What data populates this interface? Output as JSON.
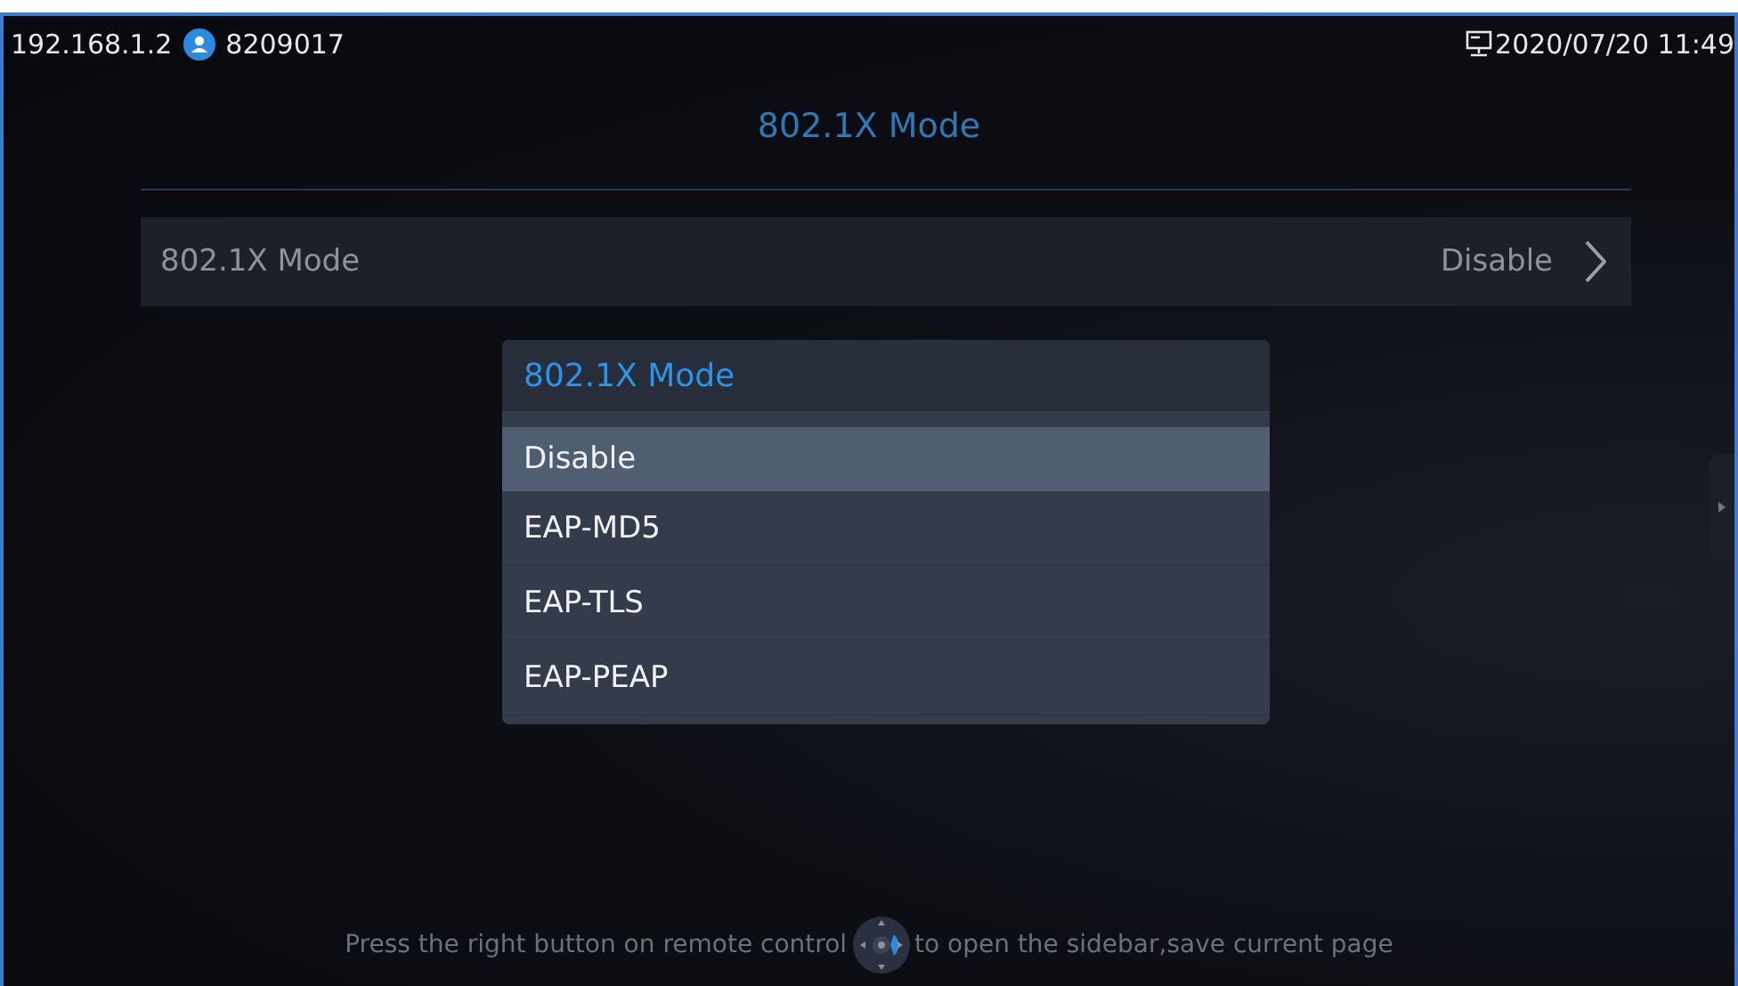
{
  "status_bar": {
    "ip": "192.168.1.2",
    "account": "8209017",
    "datetime": "2020/07/20 11:49"
  },
  "page_title": "802.1X Mode",
  "setting_row": {
    "label": "802.1X Mode",
    "value": "Disable"
  },
  "dialog": {
    "title": "802.1X Mode",
    "options": [
      {
        "label": "Disable",
        "selected": true
      },
      {
        "label": "EAP-MD5",
        "selected": false
      },
      {
        "label": "EAP-TLS",
        "selected": false
      },
      {
        "label": "EAP-PEAP",
        "selected": false
      }
    ]
  },
  "hint": {
    "before": "Press the right button on remote control",
    "after": "to open the sidebar,save current page"
  }
}
